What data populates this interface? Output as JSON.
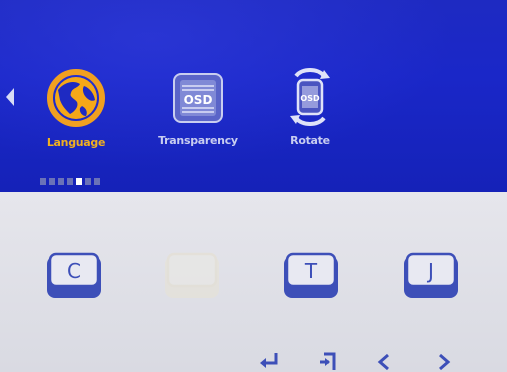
{
  "menu": {
    "items": [
      {
        "label": "Language",
        "icon": "globe-icon",
        "selected": true
      },
      {
        "label": "Transparency",
        "icon": "osd-transparency-icon",
        "selected": false
      },
      {
        "label": "Rotate",
        "icon": "osd-rotate-icon",
        "selected": false
      }
    ],
    "page_indicator": {
      "total": 7,
      "active_index": 4
    }
  },
  "osd_icon_text": "OSD",
  "keys": [
    {
      "letter": "C",
      "enabled": true
    },
    {
      "letter": "",
      "enabled": false
    },
    {
      "letter": "T",
      "enabled": true
    },
    {
      "letter": "J",
      "enabled": true
    }
  ],
  "nav_icons": [
    "enter-icon",
    "exit-icon",
    "left-arrow-icon",
    "right-arrow-icon"
  ],
  "colors": {
    "header_blue": "#1e2ac2",
    "selected_orange": "#f0a020",
    "key_blue": "#3d4fb8",
    "panel_gray": "#dcdde4"
  }
}
